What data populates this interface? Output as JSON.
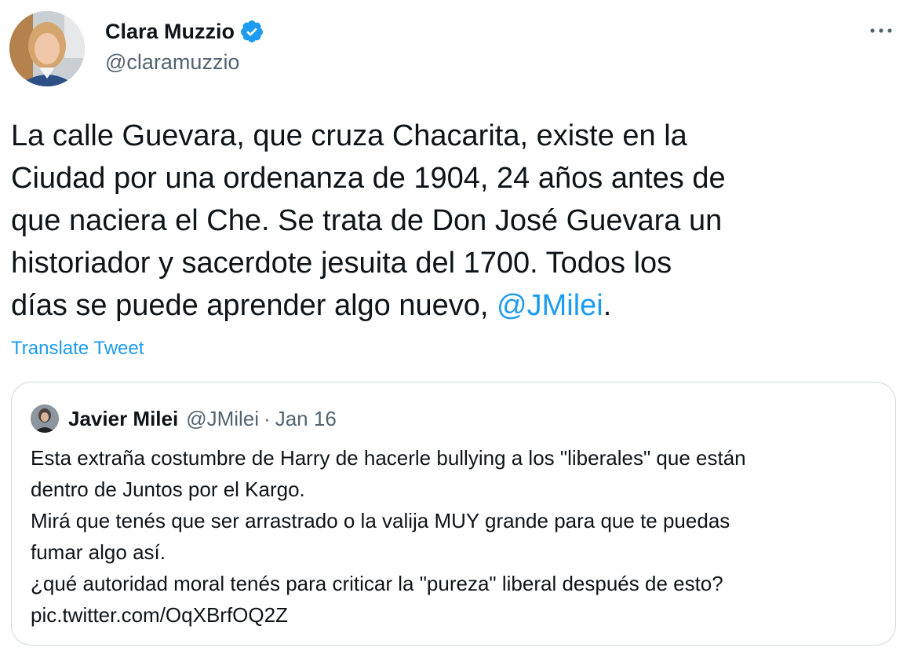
{
  "tweet": {
    "author": {
      "display_name": "Clara Muzzio",
      "handle": "@claramuzzio",
      "verified": true
    },
    "text_before_mention": "La calle Guevara, que cruza Chacarita, existe en la\nCiudad por una ordenanza de 1904, 24 años antes de\nque naciera el Che. Se trata de Don José Guevara un\nhistoriador y sacerdote jesuita del 1700. Todos los\ndías se puede aprender algo nuevo, ",
    "mention": "@JMilei",
    "text_after_mention": ".",
    "translate_label": "Translate Tweet"
  },
  "quoted_tweet": {
    "display_name": "Javier Milei",
    "handle": "@JMilei",
    "separator": "·",
    "date": "Jan 16",
    "lines": [
      "Esta extraña costumbre de Harry de hacerle bullying a los \"liberales\" que están",
      "dentro de Juntos por el Kargo.",
      "Mirá que tenés que ser arrastrado o la valija MUY grande para que te puedas",
      "fumar algo así.",
      "¿qué autoridad moral tenés para criticar la \"pureza\" liberal después de esto?",
      "pic.twitter.com/OqXBrfOQ2Z"
    ]
  },
  "icons": {
    "verified": "verified-badge-icon",
    "more": "more-options-icon"
  },
  "colors": {
    "accent": "#1d9bf0",
    "text_primary": "#0f1419",
    "text_secondary": "#536471",
    "border": "#cfd9de"
  }
}
